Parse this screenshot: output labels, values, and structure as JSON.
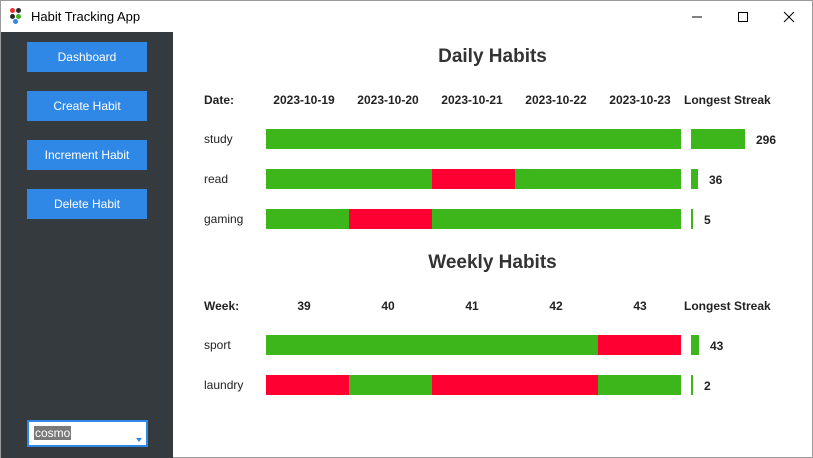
{
  "window": {
    "title": "Habit Tracking App"
  },
  "sidebar": {
    "buttons": [
      {
        "label": "Dashboard"
      },
      {
        "label": "Create Habit"
      },
      {
        "label": "Increment Habit"
      },
      {
        "label": "Delete Habit"
      }
    ],
    "user_select": {
      "value": "cosmo"
    }
  },
  "colors": {
    "done": "#3cb61b",
    "missed": "#ff0033",
    "button": "#2f87e6",
    "sidebar": "#353a3e"
  },
  "daily": {
    "title": "Daily Habits",
    "period_label": "Date:",
    "columns": [
      "2023-10-19",
      "2023-10-20",
      "2023-10-21",
      "2023-10-22",
      "2023-10-23"
    ],
    "streak_header": "Longest Streak",
    "habits": [
      {
        "name": "study",
        "status": [
          1,
          1,
          1,
          1,
          1
        ],
        "streak": "296",
        "streak_value": 296
      },
      {
        "name": "read",
        "status": [
          1,
          1,
          0,
          1,
          1
        ],
        "streak": "36",
        "streak_value": 36
      },
      {
        "name": "gaming",
        "status": [
          1,
          0,
          1,
          1,
          1
        ],
        "streak": "5",
        "streak_value": 5
      }
    ]
  },
  "weekly": {
    "title": "Weekly Habits",
    "period_label": "Week:",
    "columns": [
      "39",
      "40",
      "41",
      "42",
      "43"
    ],
    "streak_header": "Longest Streak",
    "habits": [
      {
        "name": "sport",
        "status": [
          1,
          1,
          1,
          1,
          0
        ],
        "streak": "43",
        "streak_value": 43
      },
      {
        "name": "laundry",
        "status": [
          0,
          1,
          0,
          0,
          1
        ],
        "streak": "2",
        "streak_value": 2
      }
    ]
  }
}
